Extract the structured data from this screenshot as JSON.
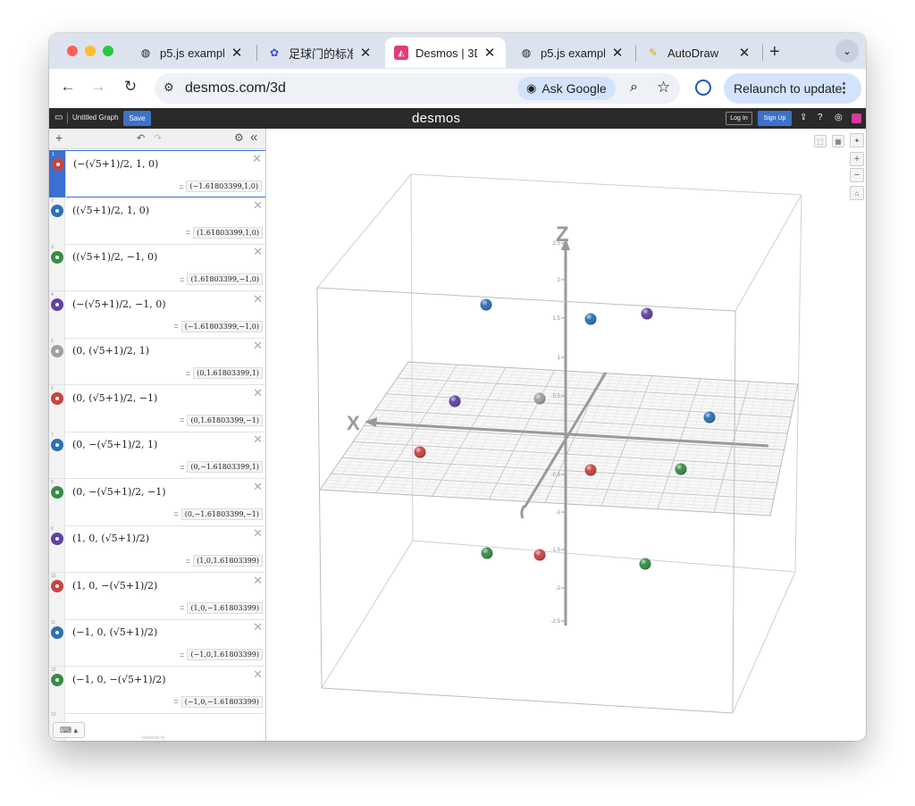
{
  "browser": {
    "tabs": [
      {
        "title": "p5.js example",
        "icon": "globe-icon",
        "active": false
      },
      {
        "title": "足球门的标准",
        "icon": "baidu-paw-icon",
        "active": false
      },
      {
        "title": "Desmos | 3D",
        "icon": "desmos-icon",
        "active": true
      },
      {
        "title": "p5.js example",
        "icon": "globe-icon",
        "active": false
      },
      {
        "title": "AutoDraw",
        "icon": "autodraw-pencil-icon",
        "active": false
      }
    ],
    "new_tab": "+",
    "url": "desmos.com/3d",
    "ask_google": "Ask Google",
    "relaunch": "Relaunch to update"
  },
  "desmos": {
    "graph_title": "Untitled Graph",
    "save": "Save",
    "logo": "desmos",
    "login": "Log In",
    "signup": "Sign Up"
  },
  "expressions": [
    {
      "n": "1",
      "latex": "(−(√5+1)/2, 1, 0)",
      "eval": "(−1.61803399,1,0)",
      "color": "#c74440"
    },
    {
      "n": "2",
      "latex": "((√5+1)/2, 1, 0)",
      "eval": "(1.61803399,1,0)",
      "color": "#2d70b3"
    },
    {
      "n": "3",
      "latex": "((√5+1)/2, −1, 0)",
      "eval": "(1.61803399,−1,0)",
      "color": "#388c46"
    },
    {
      "n": "4",
      "latex": "(−(√5+1)/2, −1, 0)",
      "eval": "(−1.61803399,−1,0)",
      "color": "#6042a6"
    },
    {
      "n": "5",
      "latex": "(0, (√5+1)/2, 1)",
      "eval": "(0,1.61803399,1)",
      "color": "#a0a0a0"
    },
    {
      "n": "6",
      "latex": "(0, (√5+1)/2, −1)",
      "eval": "(0,1.61803399,−1)",
      "color": "#c74440"
    },
    {
      "n": "7",
      "latex": "(0, −(√5+1)/2, 1)",
      "eval": "(0,−1.61803399,1)",
      "color": "#2d70b3"
    },
    {
      "n": "8",
      "latex": "(0, −(√5+1)/2, −1)",
      "eval": "(0,−1.61803399,−1)",
      "color": "#388c46"
    },
    {
      "n": "9",
      "latex": "(1, 0, (√5+1)/2)",
      "eval": "(1,0,1.61803399)",
      "color": "#6042a6"
    },
    {
      "n": "10",
      "latex": "(1, 0, −(√5+1)/2)",
      "eval": "(1,0,−1.61803399)",
      "color": "#c74440"
    },
    {
      "n": "11",
      "latex": "(−1, 0, (√5+1)/2)",
      "eval": "(−1,0,1.61803399)",
      "color": "#2d70b3"
    },
    {
      "n": "12",
      "latex": "(−1, 0, −(√5+1)/2)",
      "eval": "(−1,0,−1.61803399)",
      "color": "#388c46"
    }
  ],
  "empty_expression_number": "13",
  "powered_by": "powered by",
  "graph": {
    "axis_labels": {
      "x": "X",
      "z": "Z"
    },
    "z_ticks": [
      "2.5",
      "2",
      "1.5",
      "1",
      "0.5",
      "-0.5",
      "-1",
      "-1.5",
      "-2",
      "-2.5"
    ]
  }
}
